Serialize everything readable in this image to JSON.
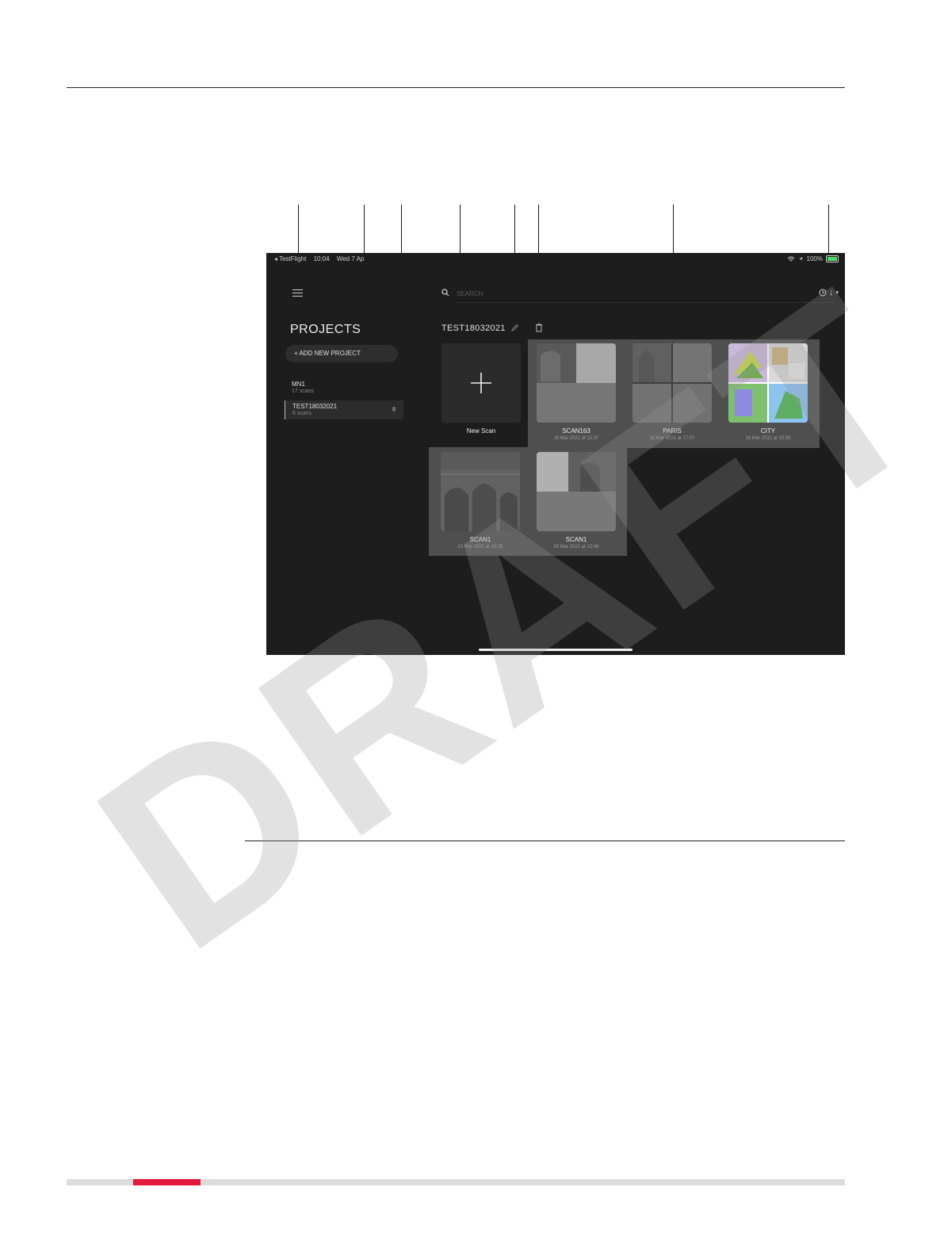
{
  "watermark": "DRAFT",
  "status_bar": {
    "back_app": "◂ TestFlight",
    "time": "10:04",
    "date": "Wed 7 Ap",
    "battery": "100%"
  },
  "sidebar": {
    "title": "PROJECTS",
    "add_button": "+ ADD NEW PROJECT",
    "projects": [
      {
        "name": "MN1",
        "count": "17 scans"
      },
      {
        "name": "TEST18032021",
        "count": "6 scans"
      }
    ]
  },
  "search": {
    "placeholder": "SEARCH"
  },
  "sort": {
    "arrow": "↓",
    "caret": "▾"
  },
  "project_header": {
    "title": "TEST18032021"
  },
  "new_scan": {
    "label": "New Scan"
  },
  "scans": [
    {
      "name": "SCAN163",
      "date": "18 Mar 2021 at 12:37"
    },
    {
      "name": "PARIS",
      "date": "18 Mar 2021 at 17:07"
    },
    {
      "name": "CITY",
      "date": "18 Mar 2021 at 15:59"
    },
    {
      "name": "SCAN1",
      "date": "23 Mar 2021 at 10:25"
    },
    {
      "name": "SCAN1",
      "date": "29 Mar 2021 at 12:06"
    }
  ],
  "colors": {
    "ipad_background": "#1d1d1d",
    "scan_group_background": "#4f4f4f",
    "footer_accent": "#e4183c",
    "footer_bar": "#dcdcdc"
  }
}
